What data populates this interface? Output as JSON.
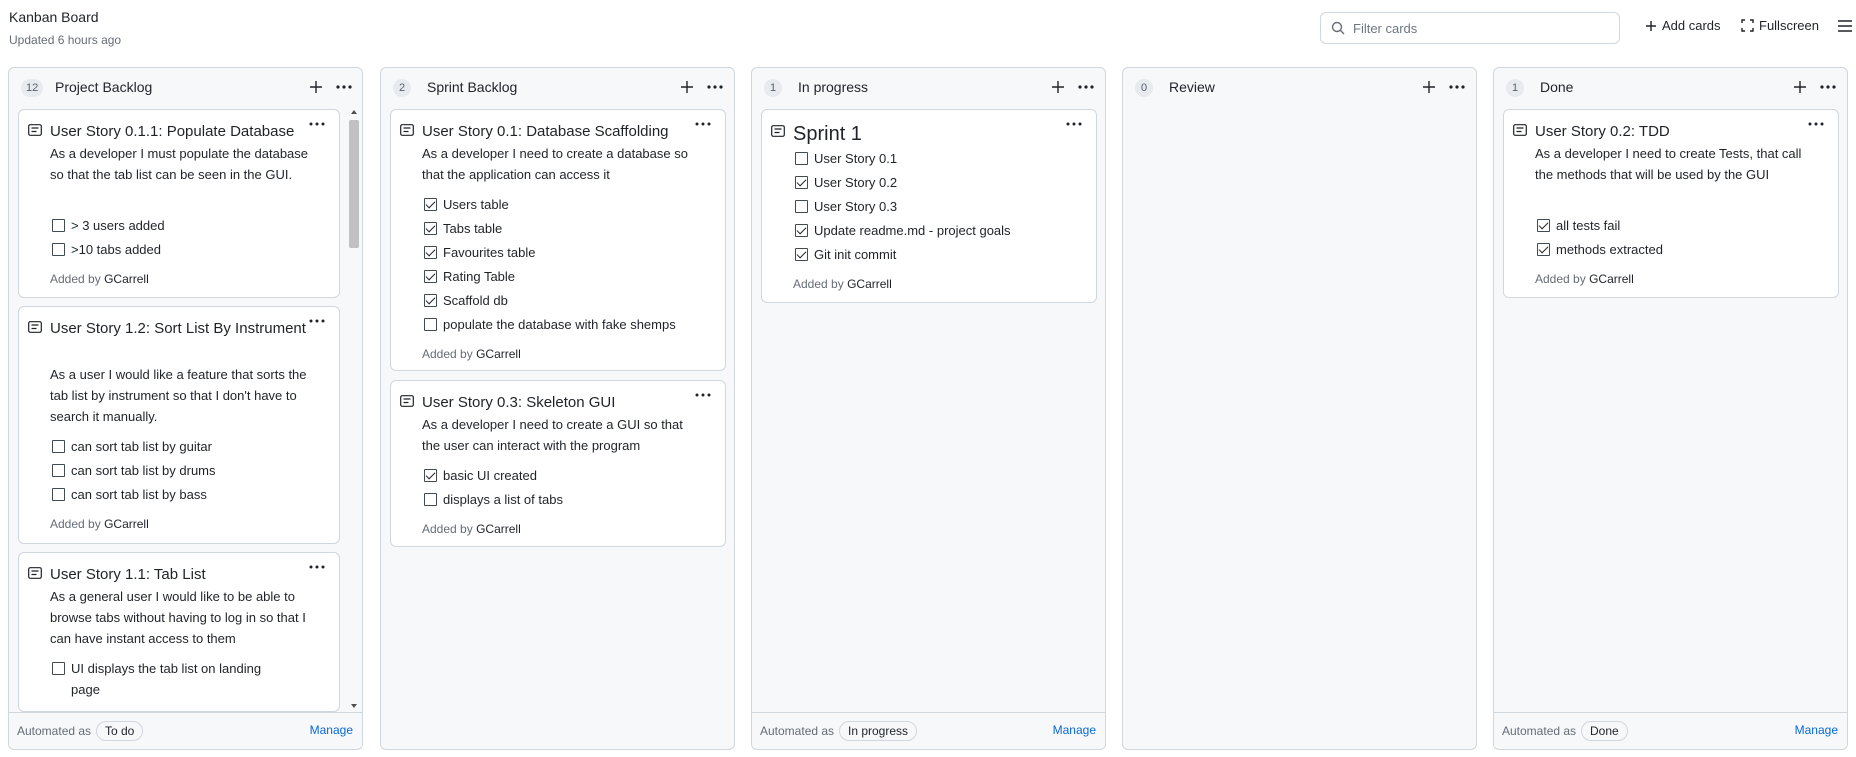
{
  "header": {
    "title": "Kanban Board",
    "updated": "Updated 6 hours ago",
    "filter_placeholder": "Filter cards",
    "add_cards": "Add cards",
    "fullscreen": "Fullscreen"
  },
  "columns": [
    {
      "count": "12",
      "name": "Project Backlog",
      "footer": {
        "automated_as": "Automated as",
        "status": "To do",
        "manage": "Manage"
      },
      "cards": [
        {
          "title": "User Story 0.1.1: Populate Database",
          "desc": "As a developer I must populate the database so that the tab list can be seen in the GUI.",
          "checks": [
            {
              "label": "> 3 users added",
              "checked": false
            },
            {
              "label": ">10 tabs added",
              "checked": false
            }
          ],
          "added_by": "Added by",
          "author": "GCarrell"
        },
        {
          "title": "User Story 1.2: Sort List By Instrument",
          "desc": "As a user I would like a feature that sorts the tab list by instrument so that I don't have to search it manually.",
          "checks": [
            {
              "label": "can sort tab list by guitar",
              "checked": false
            },
            {
              "label": "can sort tab list by drums",
              "checked": false
            },
            {
              "label": "can sort tab list by bass",
              "checked": false
            }
          ],
          "added_by": "Added by",
          "author": "GCarrell"
        },
        {
          "title": "User Story 1.1: Tab List",
          "desc": "As a general user I would like to be able to browse tabs without having to log in so that I can have instant access to them",
          "checks": [
            {
              "label": "UI displays the tab list on landing page",
              "checked": false
            }
          ]
        }
      ]
    },
    {
      "count": "2",
      "name": "Sprint Backlog",
      "cards": [
        {
          "title": "User Story 0.1: Database Scaffolding",
          "desc": "As a developer I need to create a database so that the application can access it",
          "checks": [
            {
              "label": "Users table",
              "checked": true
            },
            {
              "label": "Tabs table",
              "checked": true
            },
            {
              "label": "Favourites table",
              "checked": true
            },
            {
              "label": "Rating Table",
              "checked": true
            },
            {
              "label": "Scaffold db",
              "checked": true
            },
            {
              "label": "populate the database with fake shemps",
              "checked": false
            }
          ],
          "added_by": "Added by",
          "author": "GCarrell"
        },
        {
          "title": "User Story 0.3: Skeleton GUI",
          "desc": "As a developer I need to create a GUI so that the user can interact with the program",
          "checks": [
            {
              "label": "basic UI created",
              "checked": true
            },
            {
              "label": "displays a list of tabs",
              "checked": false
            }
          ],
          "added_by": "Added by",
          "author": "GCarrell"
        }
      ]
    },
    {
      "count": "1",
      "name": "In progress",
      "footer": {
        "automated_as": "Automated as",
        "status": "In progress",
        "manage": "Manage"
      },
      "cards": [
        {
          "title": "Sprint 1",
          "checks": [
            {
              "label": "User Story 0.1",
              "checked": false
            },
            {
              "label": "User Story 0.2",
              "checked": true
            },
            {
              "label": "User Story 0.3",
              "checked": false
            },
            {
              "label": "Update readme.md - project goals",
              "checked": true
            },
            {
              "label": "Git init commit",
              "checked": true
            }
          ],
          "added_by": "Added by",
          "author": "GCarrell"
        }
      ]
    },
    {
      "count": "0",
      "name": "Review",
      "cards": []
    },
    {
      "count": "1",
      "name": "Done",
      "footer": {
        "automated_as": "Automated as",
        "status": "Done",
        "manage": "Manage"
      },
      "cards": [
        {
          "title": "User Story 0.2: TDD",
          "desc": "As a developer I need to create Tests, that call the methods that will be used by the GUI",
          "checks": [
            {
              "label": "all tests fail",
              "checked": true
            },
            {
              "label": "methods extracted",
              "checked": true
            }
          ],
          "added_by": "Added by",
          "author": "GCarrell"
        }
      ]
    }
  ]
}
